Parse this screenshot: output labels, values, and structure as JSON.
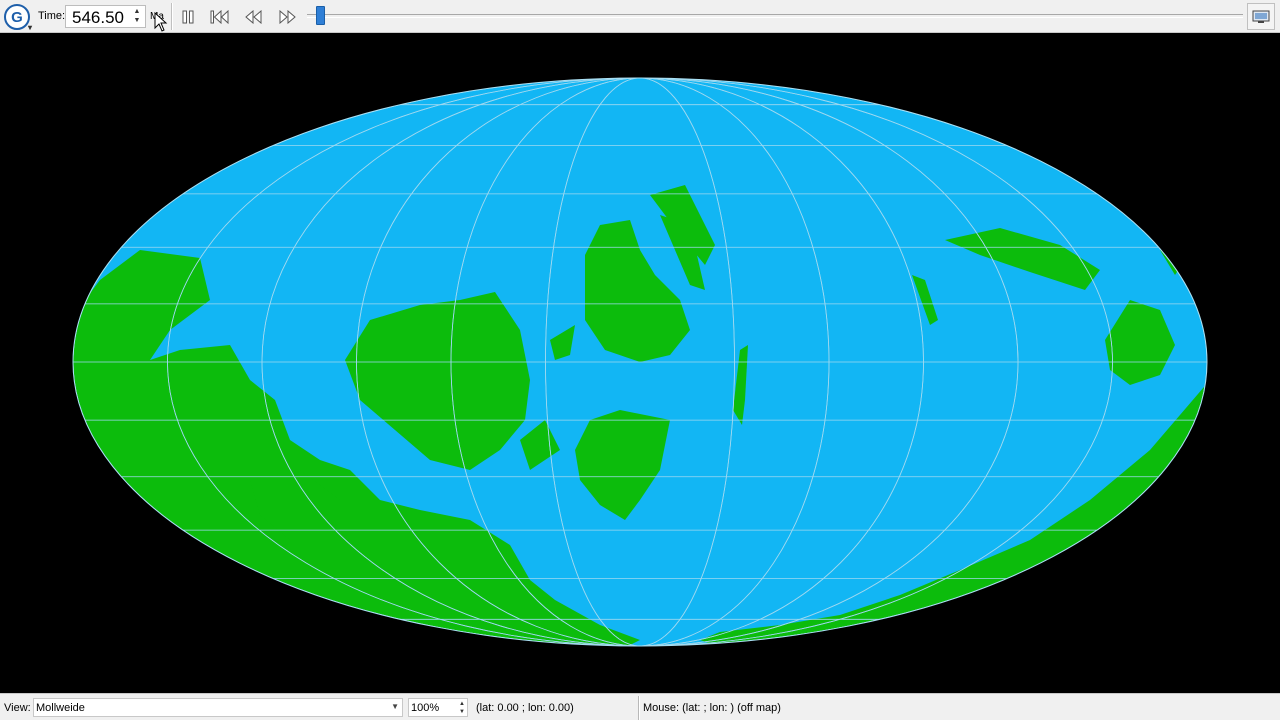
{
  "toolbar": {
    "logo_letter": "G",
    "time_label": "Time:",
    "time_value": "546.50",
    "time_units": "Ma",
    "buttons": [
      "pause-icon",
      "rewind-to-start-icon",
      "step-backward-icon",
      "step-forward-icon"
    ],
    "animation_progress": 0.01,
    "right_button_icon": "fullscreen-icon"
  },
  "map": {
    "projection": "Mollweide",
    "ocean_color": "#12b6f4",
    "land_color": "#0cbc0c",
    "graticule_color": "#9ed8f0",
    "background_color": "#000000"
  },
  "statusbar": {
    "view_label": "View:",
    "view_value": "Mollweide",
    "zoom_value": "100%",
    "camera_text": "(lat: 0.00 ; lon: 0.00)",
    "mouse_text": "Mouse: (lat: ; lon: ) (off map)"
  }
}
